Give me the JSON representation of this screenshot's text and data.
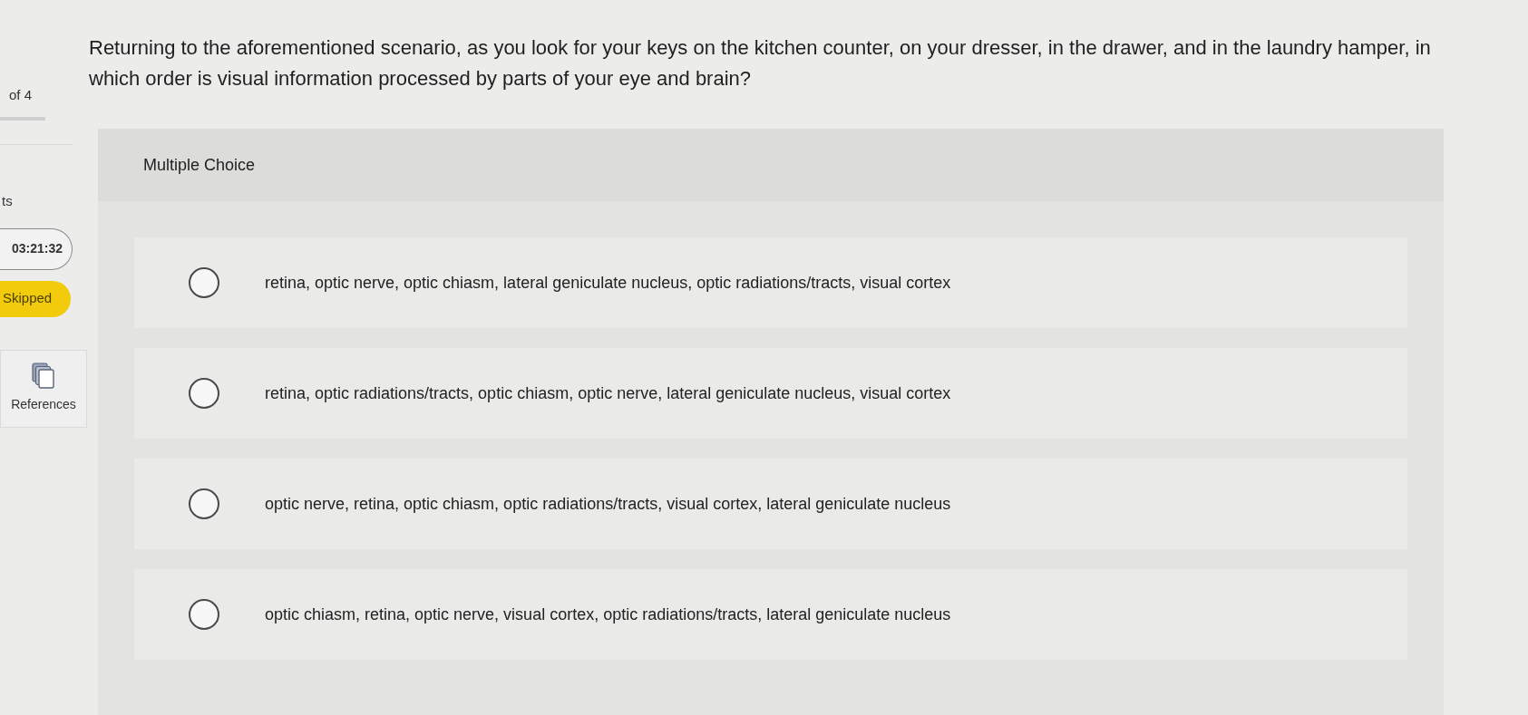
{
  "sidebar": {
    "progress_text": "of 4",
    "points_label": "ts",
    "timer": "03:21:32",
    "status_badge": "Skipped",
    "references_button": {
      "label": "References"
    }
  },
  "question": {
    "text": "Returning to the aforementioned scenario, as you look for your keys on the kitchen counter, on your dresser, in the drawer, and in the laundry hamper, in which order is visual information processed by parts of your eye and brain?",
    "type_label": "Multiple Choice"
  },
  "options": [
    {
      "label": "retina, optic nerve, optic chiasm, lateral geniculate nucleus, optic radiations/tracts, visual cortex",
      "selected": false
    },
    {
      "label": "retina, optic radiations/tracts, optic chiasm, optic nerve, lateral geniculate nucleus, visual cortex",
      "selected": false
    },
    {
      "label": "optic nerve, retina, optic chiasm, optic radiations/tracts, visual cortex, lateral geniculate nucleus",
      "selected": false
    },
    {
      "label": "optic chiasm, retina, optic nerve, visual cortex, optic radiations/tracts, lateral geniculate nucleus",
      "selected": false
    }
  ]
}
